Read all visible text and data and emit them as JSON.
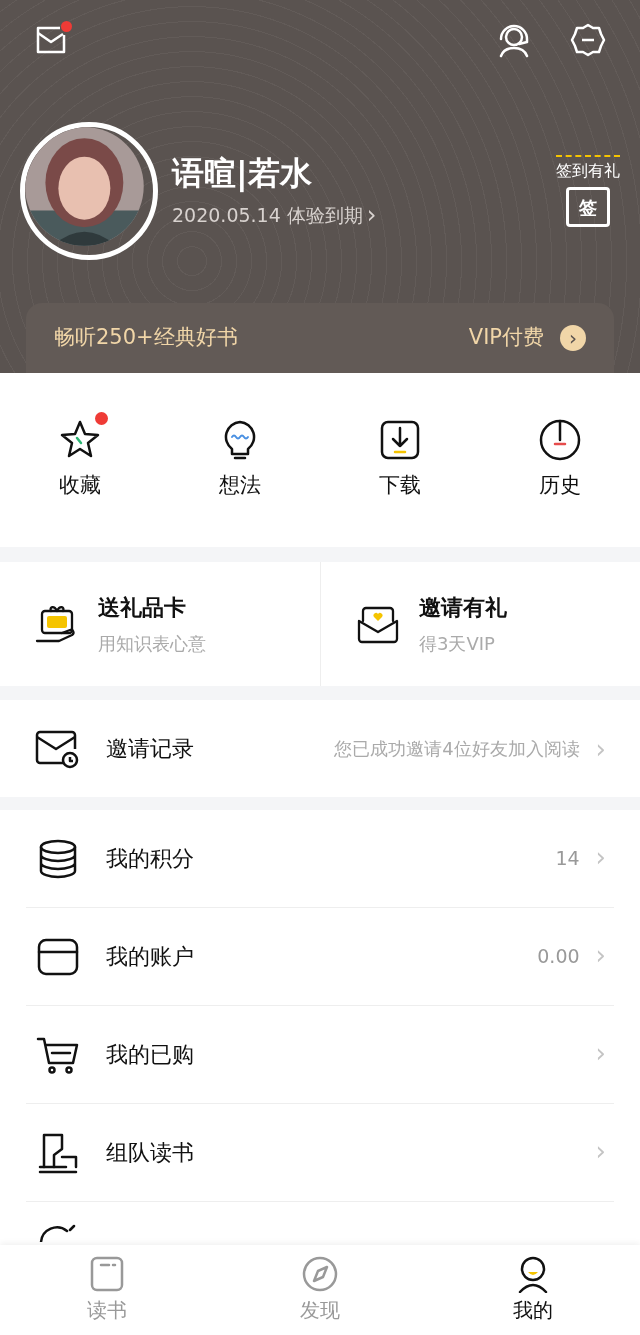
{
  "header": {
    "mail": {
      "unread": true
    },
    "user": {
      "name": "语暄|若水",
      "expiry": "2020.05.14 体验到期",
      "expiry_arrow": "›"
    },
    "checkin": {
      "label": "签到有礼",
      "stamp": "签"
    },
    "vip_banner": {
      "text": "畅听250+经典好书",
      "action": "VIP付费",
      "arrow": "›"
    }
  },
  "quick_actions": [
    {
      "kind": "star",
      "label": "收藏",
      "unread": true
    },
    {
      "kind": "bulb",
      "label": "想法",
      "unread": false
    },
    {
      "kind": "download",
      "label": "下载",
      "unread": false
    },
    {
      "kind": "clock",
      "label": "历史",
      "unread": false
    }
  ],
  "cards": [
    {
      "kind": "gift",
      "title": "送礼品卡",
      "subtitle": "用知识表心意"
    },
    {
      "kind": "invite",
      "title": "邀请有礼",
      "subtitle": "得3天VIP"
    }
  ],
  "invite_row": {
    "label": "邀请记录",
    "value": "您已成功邀请4位好友加入阅读",
    "arrow": "›"
  },
  "menu": [
    {
      "kind": "coins",
      "label": "我的积分",
      "value": "14",
      "arrow": "›"
    },
    {
      "kind": "wallet",
      "label": "我的账户",
      "value": "0.00",
      "arrow": "›"
    },
    {
      "kind": "cart",
      "label": "我的已购",
      "arrow": "›"
    },
    {
      "kind": "team",
      "label": "组队读书",
      "arrow": "›"
    }
  ],
  "bottom_nav": [
    {
      "kind": "book",
      "label": "读书",
      "selected": false
    },
    {
      "kind": "compass",
      "label": "发现",
      "selected": false
    },
    {
      "kind": "person",
      "label": "我的",
      "selected": true
    }
  ]
}
